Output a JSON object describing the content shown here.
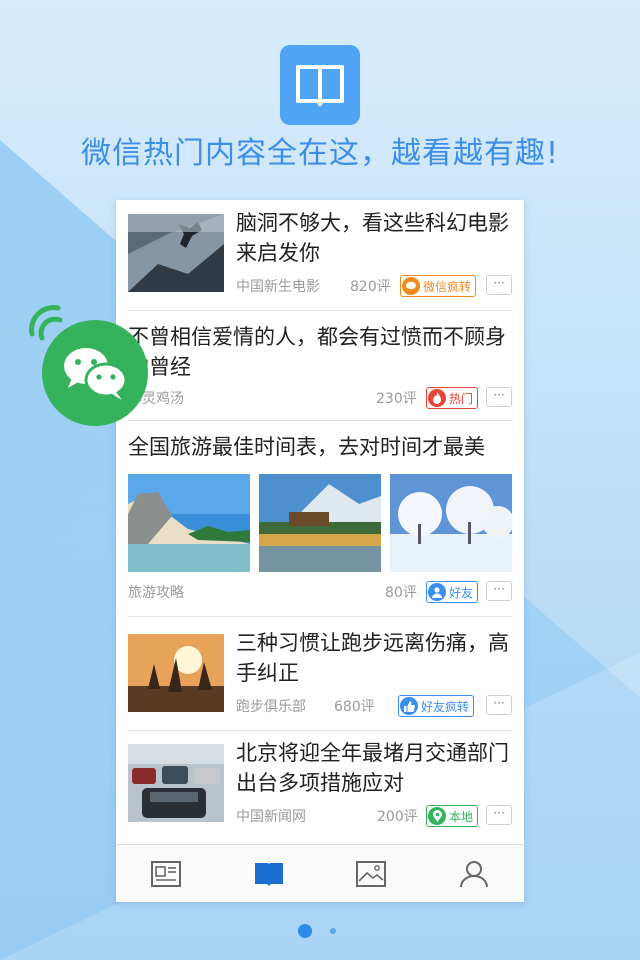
{
  "tagline": "微信热门内容全在这，越看越有趣!",
  "colors": {
    "accent": "#3d8ee6",
    "wechat_green": "#35b35c",
    "hot_red": "#e8453a",
    "orange": "#f08a1f",
    "blue": "#3a8ef0",
    "green": "#2fb45a"
  },
  "icons": {
    "logo": "open-book-icon",
    "floating": "wechat-logo-icon"
  },
  "feed": [
    {
      "title": "脑洞不够大，看这些科幻电影来启发你",
      "source": "中国新生电影",
      "comments": "820评",
      "badge": "微信疯转",
      "badge_icon": "chat-bubble-icon"
    },
    {
      "title": "不曾相信爱情的人，都会有过愤而不顾身的曾经",
      "source": "心灵鸡汤",
      "comments": "230评",
      "badge": "热门",
      "badge_icon": "flame-icon"
    },
    {
      "title": "全国旅游最佳时间表，去对时间才最美",
      "source": "旅游攻略",
      "comments": "80评",
      "badge": "好友",
      "badge_icon": "person-icon"
    },
    {
      "title": "三种习惯让跑步远离伤痛，高手纠正",
      "source": "跑步俱乐部",
      "comments": "680评",
      "badge": "好友疯转",
      "badge_icon": "thumbs-up-icon"
    },
    {
      "title": "北京将迎全年最堵月交通部门出台多项措施应对",
      "source": "中国新闻网",
      "comments": "200评",
      "badge": "本地",
      "badge_icon": "location-pin-icon"
    }
  ],
  "more_label": "···",
  "tabs": [
    {
      "icon": "news-icon",
      "active": false
    },
    {
      "icon": "book-icon",
      "active": true
    },
    {
      "icon": "picture-icon",
      "active": false
    },
    {
      "icon": "profile-icon",
      "active": false
    }
  ],
  "pager": {
    "pages": 2,
    "current": 1
  }
}
